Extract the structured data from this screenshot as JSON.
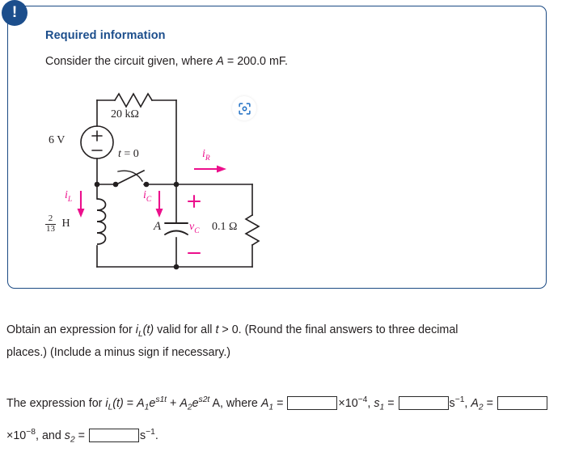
{
  "callout": {
    "badge_icon": "exclamation-icon",
    "title": "Required information",
    "intro_prefix": "Consider the circuit given, where ",
    "intro_var": "A",
    "intro_suffix": " = 200.0 mF."
  },
  "zoom_button": {
    "icon": "scan-zoom-icon"
  },
  "circuit": {
    "source_label": "6 V",
    "source_plus": "+",
    "source_minus": "−",
    "resistor_top_label": "20 kΩ",
    "switch_label_var": "t",
    "switch_label_rest": " = 0",
    "inductor_num": "2",
    "inductor_den": "13",
    "inductor_unit": "H",
    "current_inductor": "i",
    "current_inductor_sub": "L",
    "current_cap": "i",
    "current_cap_sub": "C",
    "current_res": "i",
    "current_res_sub": "R",
    "cap_label": "A",
    "cap_voltage": "v",
    "cap_voltage_sub": "C",
    "polarity_plus": "+",
    "polarity_minus": "−",
    "resistor_right_label": "0.1 Ω"
  },
  "question": {
    "line1_a": "Obtain an expression for ",
    "line1_i": "i",
    "line1_isub": "L",
    "line1_t": "(t)",
    "line1_b": " valid for all ",
    "line1_tvar": "t",
    "line1_c": " > 0. (Round the final answers to three decimal",
    "line2": "places.) (Include a minus sign if necessary.)"
  },
  "expression": {
    "lead": "The expression for ",
    "i": "i",
    "isub": "L",
    "t_paren": "(t)",
    "eq": " = ",
    "A1": "A",
    "A1sub": "1",
    "e1": "e",
    "s1t": "s1t",
    "plus": " + ",
    "A2": "A",
    "A2sub": "2",
    "e2": "e",
    "s2t": "s2t",
    "units_A": " A, where ",
    "A1_eq": "A",
    "A1_eq_sub": "1",
    "equals": " = ",
    "pow_m4_mul": "×10",
    "pow_m4_exp": "−4",
    "comma1": ", ",
    "s1": "s",
    "s1sub": "1",
    "unit_s_inv": "s",
    "unit_s_inv_exp": "−1",
    "comma2": ", ",
    "A2_eq": "A",
    "A2_eq_sub": "2",
    "pow_m8_mul": "×10",
    "pow_m8_exp": "−8",
    "and_text": ", and ",
    "s2": "s",
    "s2sub": "2",
    "unit_s_inv2": "s",
    "unit_s_inv2_exp": "−1",
    "period": ".",
    "answer_value": ""
  },
  "colors": {
    "accent_blue": "#1c4e8c",
    "pink": "#ec0f8c",
    "ink": "#231f20"
  }
}
